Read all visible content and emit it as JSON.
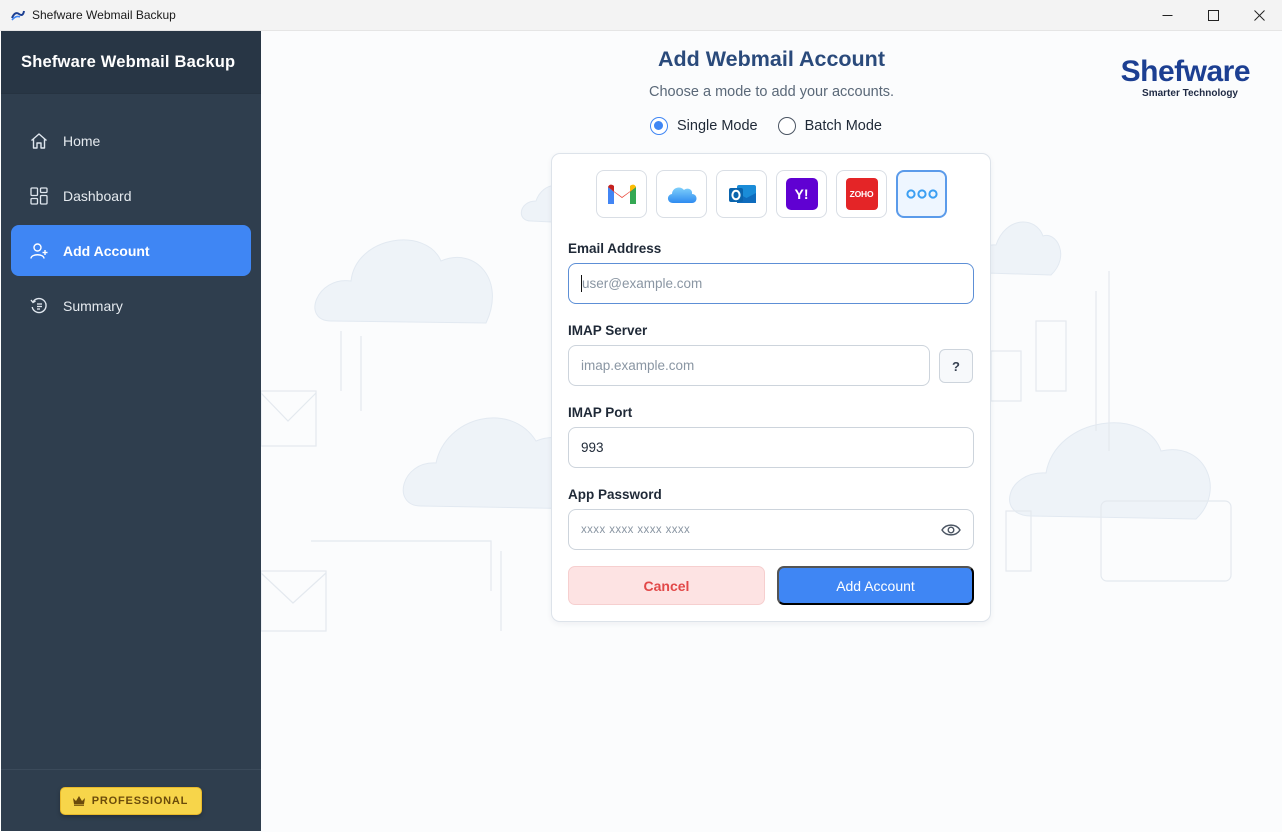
{
  "window": {
    "title": "Shefware Webmail Backup",
    "controls": [
      "minimize-icon",
      "maximize-icon",
      "close-icon"
    ]
  },
  "sidebar": {
    "title": "Shefware Webmail Backup",
    "items": [
      {
        "label": "Home",
        "icon": "home-icon"
      },
      {
        "label": "Dashboard",
        "icon": "dashboard-icon"
      },
      {
        "label": "Add Account",
        "icon": "add-user-icon",
        "active": true
      },
      {
        "label": "Summary",
        "icon": "history-icon"
      }
    ],
    "badge": "PROFESSIONAL"
  },
  "brand": {
    "name": "Shefware",
    "tagline": "Smarter Technology"
  },
  "page": {
    "title": "Add Webmail Account",
    "subtitle": "Choose a mode to add your accounts."
  },
  "modes": {
    "single": "Single Mode",
    "batch": "Batch Mode",
    "selected": "Single Mode"
  },
  "providers": [
    {
      "name": "gmail-icon"
    },
    {
      "name": "icloud-icon"
    },
    {
      "name": "outlook-icon"
    },
    {
      "name": "yahoo-icon",
      "text": "Y!"
    },
    {
      "name": "zoho-icon",
      "text": "ZOHO"
    },
    {
      "name": "more-icon",
      "selected": true
    }
  ],
  "form": {
    "email": {
      "label": "Email Address",
      "placeholder": "user@example.com"
    },
    "imap_server": {
      "label": "IMAP Server",
      "placeholder": "imap.example.com",
      "help": "?"
    },
    "imap_port": {
      "label": "IMAP Port",
      "value": "993"
    },
    "app_password": {
      "label": "App Password",
      "placeholder": "xxxx xxxx xxxx xxxx"
    },
    "cancel": "Cancel",
    "submit": "Add Account"
  },
  "colors": {
    "accent": "#3f86f4",
    "sidebar": "#2f3e4e",
    "title": "#2a4a7b",
    "cancel_bg": "#fde3e3",
    "cancel_text": "#e24848",
    "badge": "#f7d54a"
  }
}
